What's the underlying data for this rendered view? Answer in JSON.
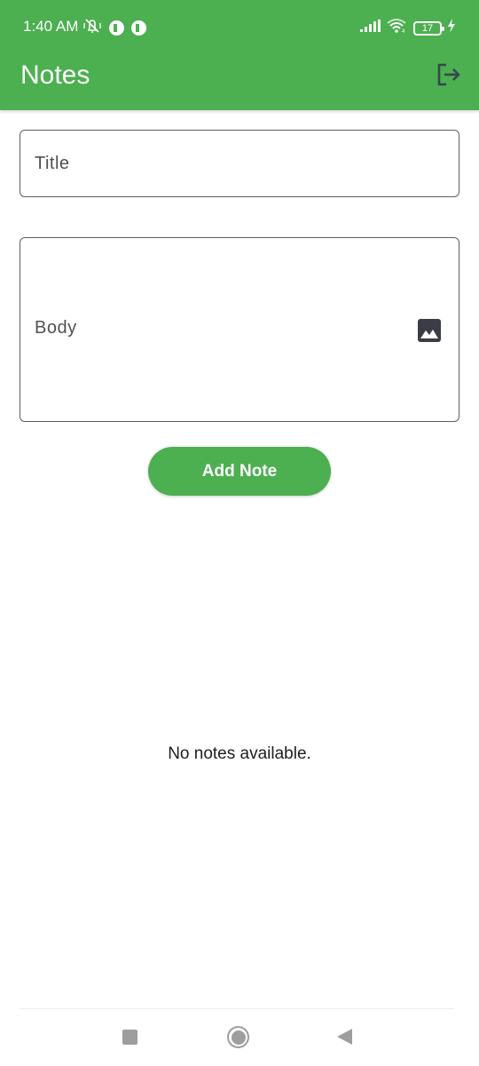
{
  "status_bar": {
    "time": "1:40 AM",
    "left_icons": [
      "vibrate-off-icon",
      "app-notification-icon",
      "app-notification-icon"
    ],
    "right_icons": [
      "signal-icon",
      "wifi-icon",
      "battery-icon",
      "charging-icon"
    ],
    "battery_level": "17"
  },
  "app_bar": {
    "title": "Notes",
    "action_icon": "logout-icon"
  },
  "form": {
    "title_placeholder": "Title",
    "title_value": "",
    "body_placeholder": "Body",
    "body_value": "",
    "image_icon": "image-icon",
    "submit_label": "Add Note"
  },
  "notes": {
    "items": [],
    "empty_message": "No notes available."
  },
  "nav_bar": {
    "buttons": [
      "recents",
      "home",
      "back"
    ]
  },
  "colors": {
    "primary": "#4caf50",
    "on_primary": "#ffffff",
    "field_border": "#5f5f5f",
    "nav_icon": "#9e9e9e"
  }
}
